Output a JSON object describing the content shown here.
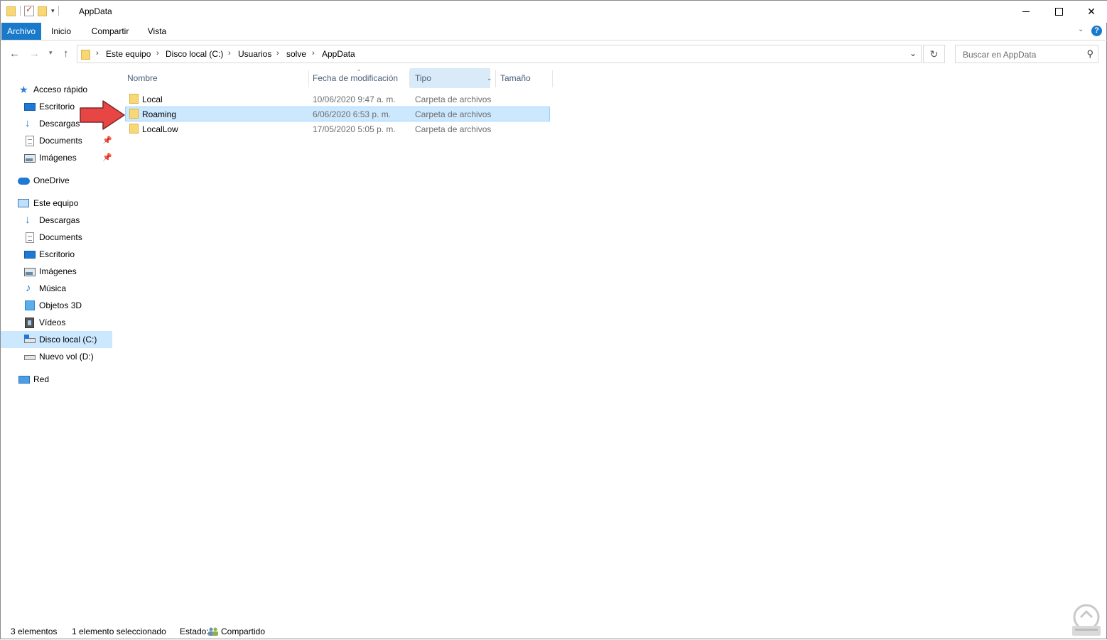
{
  "window": {
    "title": "AppData",
    "controls": {
      "minimize": "minimize",
      "maximize": "maximize",
      "close": "✕"
    }
  },
  "ribbon": {
    "tabs": [
      {
        "label": "Archivo",
        "active": true
      },
      {
        "label": "Inicio"
      },
      {
        "label": "Compartir"
      },
      {
        "label": "Vista"
      }
    ],
    "help": "?"
  },
  "nav": {
    "breadcrumbs": [
      "Este equipo",
      "Disco local (C:)",
      "Usuarios",
      "solve",
      "AppData"
    ],
    "search_placeholder": "Buscar en AppData"
  },
  "sidebar": {
    "sections": {
      "quick_access": {
        "label": "Acceso rápido"
      },
      "onedrive": {
        "label": "OneDrive"
      },
      "this_pc": {
        "label": "Este equipo"
      },
      "network": {
        "label": "Red"
      }
    },
    "quick_items": [
      {
        "label": "Escritorio",
        "icon": "desktop-icon"
      },
      {
        "label": "Descargas",
        "icon": "downloads-icon"
      },
      {
        "label": "Documents",
        "icon": "documents-icon",
        "pinned": true
      },
      {
        "label": "Imágenes",
        "icon": "pictures-icon",
        "pinned": true
      }
    ],
    "pc_items": [
      {
        "label": "Descargas",
        "icon": "downloads-icon"
      },
      {
        "label": "Documents",
        "icon": "documents-icon"
      },
      {
        "label": "Escritorio",
        "icon": "desktop-icon"
      },
      {
        "label": "Imágenes",
        "icon": "pictures-icon"
      },
      {
        "label": "Música",
        "icon": "music-icon"
      },
      {
        "label": "Objetos 3D",
        "icon": "3d-objects-icon"
      },
      {
        "label": "Vídeos",
        "icon": "videos-icon"
      },
      {
        "label": "Disco local (C:)",
        "icon": "os-drive-icon",
        "selected": true
      },
      {
        "label": "Nuevo vol (D:)",
        "icon": "drive-icon"
      }
    ]
  },
  "columns": {
    "name": "Nombre",
    "modified": "Fecha de modificación",
    "type": "Tipo",
    "size": "Tamaño",
    "sorted_column": "Tipo"
  },
  "files": [
    {
      "name": "Local",
      "modified": "10/06/2020 9:47 a. m.",
      "type": "Carpeta de archivos",
      "selected": false
    },
    {
      "name": "Roaming",
      "modified": "6/06/2020 6:53 p. m.",
      "type": "Carpeta de archivos",
      "selected": true
    },
    {
      "name": "LocalLow",
      "modified": "17/05/2020 5:05 p. m.",
      "type": "Carpeta de archivos",
      "selected": false
    }
  ],
  "status": {
    "count": "3 elementos",
    "selection": "1 elemento seleccionado",
    "state_label": "Estado:",
    "state_value": "Compartido"
  },
  "colors": {
    "accent": "#1979ca",
    "selection": "#cce8ff",
    "annotation_arrow": "#e84545"
  }
}
